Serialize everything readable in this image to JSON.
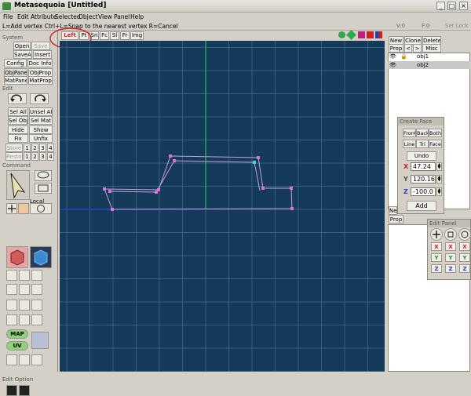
{
  "app": {
    "title": "Metasequoia [Untitled]"
  },
  "menu": [
    "File",
    "Edit",
    "Attribute",
    "Selected",
    "Object",
    "View",
    "Panel",
    "Help"
  ],
  "status": {
    "hint": "L=Add vertex  Ctrl+L=Snap to the nearest vertex  R=Cancel",
    "v": "V:0",
    "f": "F:0",
    "setlock": "Set Lock"
  },
  "system": {
    "section": "System",
    "open": "Open",
    "save": "Save",
    "saveas": "SaveAs",
    "insert": "Insert",
    "config": "Config",
    "docinfo": "Doc Info",
    "objpanel": "ObjPane",
    "objprop": "ObjProp",
    "matpanel": "MatPane",
    "matprop": "MatProp"
  },
  "edit": {
    "section": "Edit",
    "selall": "Sel All",
    "unselall": "Unsel All",
    "selobj": "Sel Obj",
    "selmat": "Sel Mat",
    "hide": "Hide",
    "show": "Show",
    "fix": "Fix",
    "unfix": "Unfix",
    "store": "Store",
    "restore": "Restore",
    "n1": "1",
    "n2": "2",
    "n3": "3",
    "n4": "4"
  },
  "command": {
    "section": "Command",
    "local": "Local",
    "map": "MAP",
    "uv": "UV"
  },
  "editoption": "Edit Option",
  "viewtabs": [
    "Left",
    "Pt",
    "Sn",
    "Fc",
    "Sl",
    "Fr",
    "Img"
  ],
  "objects": {
    "buttons": {
      "new": "New",
      "clone": "Clone",
      "delete": "Delete",
      "prop": "Prop",
      "lt": "<",
      "gt": ">",
      "misc": "Misc"
    },
    "items": [
      "obj1",
      "obj2"
    ]
  },
  "createface": {
    "title": "Create Face",
    "front": "Front",
    "back": "Back",
    "both": "Both",
    "line": "Line",
    "tri": "Tri",
    "face": "Face",
    "undo": "Undo",
    "x_label": "X",
    "y_label": "Y",
    "z_label": "Z",
    "x": "47.24",
    "y": "120.16",
    "z": "-100.0",
    "add": "Add"
  },
  "material": {
    "new": "New",
    "prop": "Prop"
  },
  "editpanel": {
    "title": "Edit Panel",
    "x": "X",
    "y": "Y",
    "z": "Z"
  },
  "colors": {
    "viewport": "#163a5a",
    "grid": "#3f6f8f",
    "edge": "#c8a0d8",
    "vertex": "#e070e0",
    "yaxis": "#2fbf4f",
    "zaxis": "#2a3fbf",
    "selected": "#e03030"
  }
}
